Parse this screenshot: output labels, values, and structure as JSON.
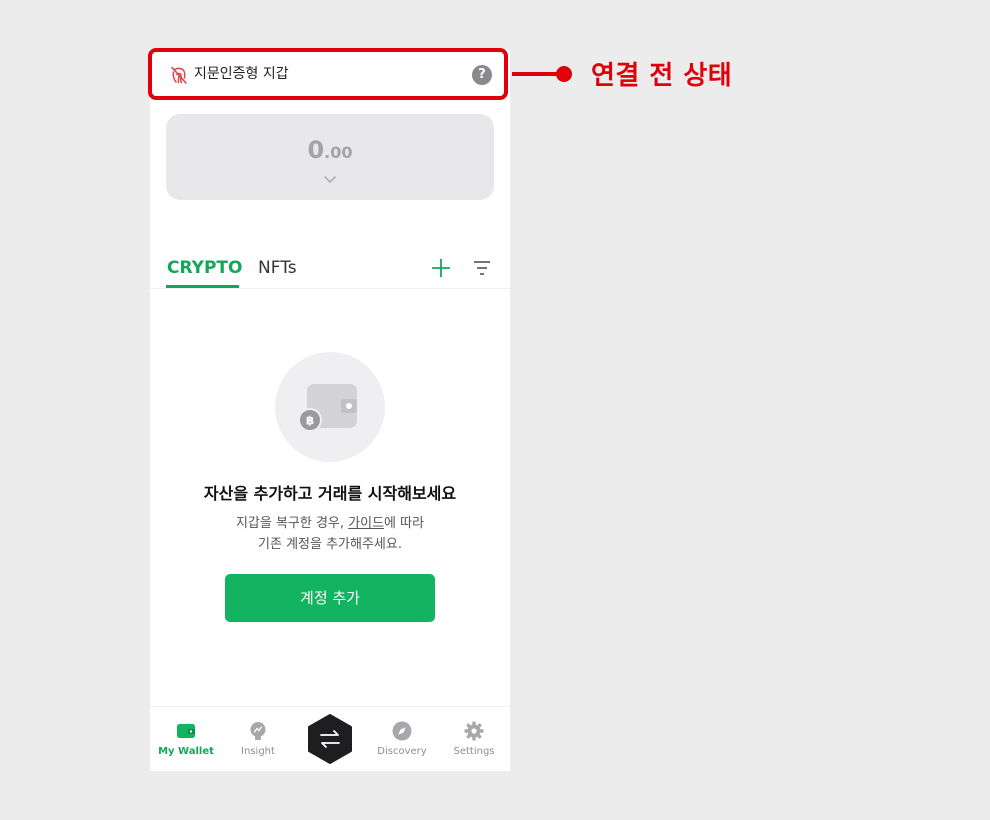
{
  "header": {
    "title": "지문인증형 지갑",
    "help_icon": "question-icon",
    "fingerprint_icon": "fingerprint-off-icon"
  },
  "annotation": {
    "label": "연결 전 상태",
    "color": "#e0000b"
  },
  "balance": {
    "integer": "0",
    "decimal": ".00"
  },
  "tabs": [
    {
      "label": "CRYPTO",
      "active": true
    },
    {
      "label": "NFTs",
      "active": false
    }
  ],
  "empty_state": {
    "title": "자산을 추가하고 거래를 시작해보세요",
    "desc_line1_prefix": "지갑을 복구한 경우, ",
    "guide_link": "가이드",
    "desc_line1_suffix": "에 따라",
    "desc_line2": "기존 계정을 추가해주세요.",
    "button": "계정 추가"
  },
  "bottom_nav": [
    {
      "label": "My Wallet",
      "icon": "wallet-icon",
      "active": true
    },
    {
      "label": "Insight",
      "icon": "lightbulb-icon",
      "active": false
    },
    {
      "label": "",
      "icon": "swap-icon",
      "active": false
    },
    {
      "label": "Discovery",
      "icon": "compass-icon",
      "active": false
    },
    {
      "label": "Settings",
      "icon": "gear-icon",
      "active": false
    }
  ],
  "colors": {
    "accent": "#12b461",
    "highlight": "#e0000b"
  }
}
